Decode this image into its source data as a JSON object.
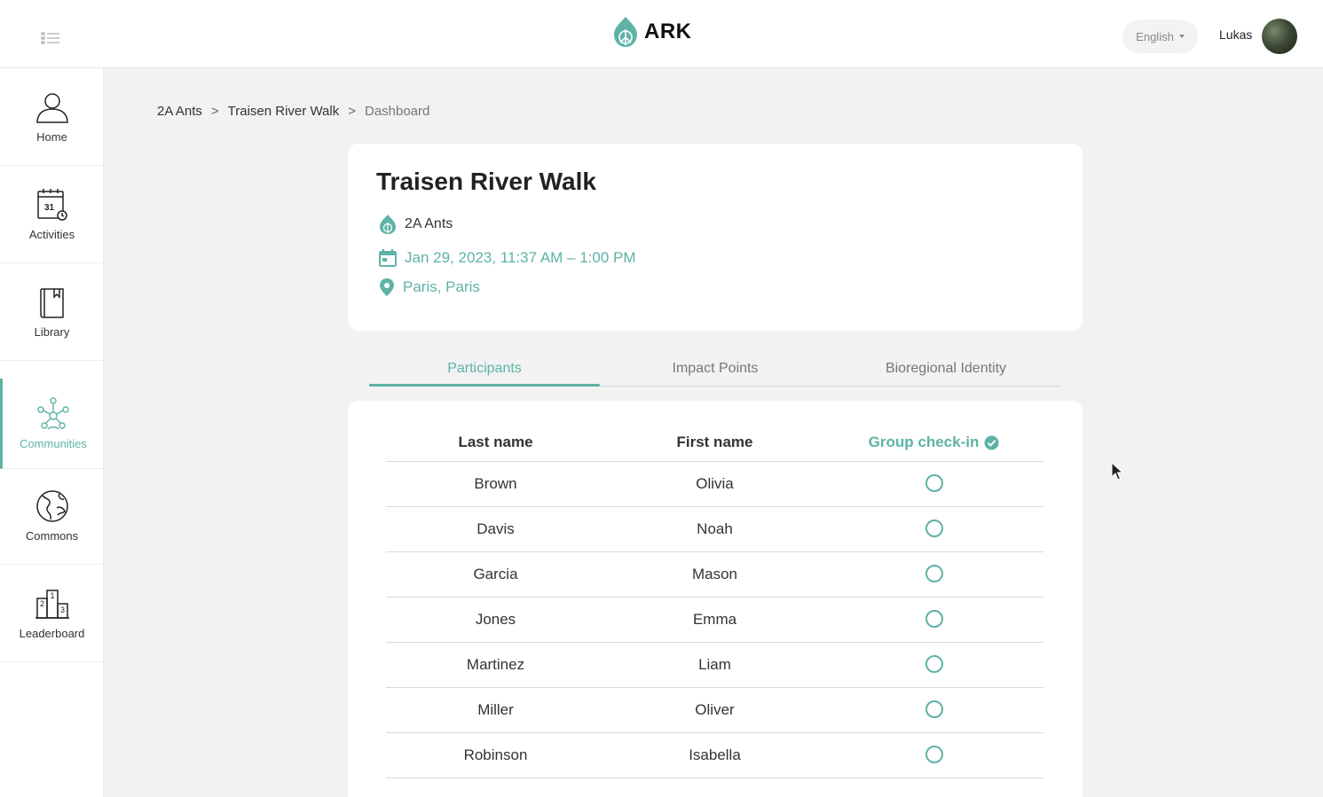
{
  "header": {
    "logo_text": "ARK",
    "language": "English",
    "username": "Lukas"
  },
  "sidebar": {
    "items": [
      {
        "label": "Home",
        "icon": "person-icon"
      },
      {
        "label": "Activities",
        "icon": "calendar-icon"
      },
      {
        "label": "Library",
        "icon": "book-icon"
      },
      {
        "label": "Communities",
        "icon": "communities-icon",
        "active": true
      },
      {
        "label": "Commons",
        "icon": "globe-icon"
      },
      {
        "label": "Leaderboard",
        "icon": "podium-icon"
      }
    ]
  },
  "breadcrumb": {
    "items": [
      "2A Ants",
      "Traisen River Walk",
      "Dashboard"
    ],
    "separator": ">"
  },
  "event": {
    "title": "Traisen River Walk",
    "organization": "2A Ants",
    "datetime": "Jan 29, 2023, 11:37 AM – 1:00 PM",
    "location": "Paris, Paris"
  },
  "tabs": [
    {
      "label": "Participants",
      "active": true
    },
    {
      "label": "Impact Points"
    },
    {
      "label": "Bioregional Identity"
    }
  ],
  "table": {
    "columns": [
      "Last name",
      "First name",
      "Group check-in"
    ],
    "rows": [
      {
        "last": "Brown",
        "first": "Olivia",
        "checked_in": false
      },
      {
        "last": "Davis",
        "first": "Noah",
        "checked_in": false
      },
      {
        "last": "Garcia",
        "first": "Mason",
        "checked_in": false
      },
      {
        "last": "Jones",
        "first": "Emma",
        "checked_in": false
      },
      {
        "last": "Martinez",
        "first": "Liam",
        "checked_in": false
      },
      {
        "last": "Miller",
        "first": "Oliver",
        "checked_in": false
      },
      {
        "last": "Robinson",
        "first": "Isabella",
        "checked_in": false
      }
    ]
  },
  "colors": {
    "accent": "#5db3a6",
    "background": "#f2f2f2",
    "card": "#ffffff"
  }
}
